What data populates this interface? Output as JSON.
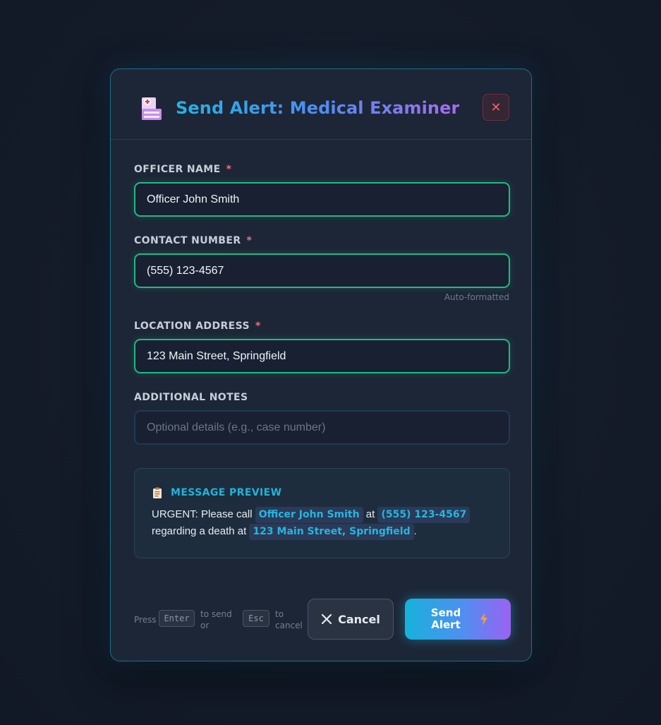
{
  "modal": {
    "title": "Send Alert: Medical Examiner",
    "icon": "hospital-icon",
    "close_label": "✕"
  },
  "form": {
    "officer_name": {
      "label": "OFFICER NAME",
      "required_mark": "*",
      "value": "Officer John Smith"
    },
    "contact_number": {
      "label": "CONTACT NUMBER",
      "required_mark": "*",
      "value": "(555) 123-4567",
      "hint": "Auto-formatted"
    },
    "location_address": {
      "label": "LOCATION ADDRESS",
      "required_mark": "*",
      "value": "123 Main Street, Springfield"
    },
    "additional_notes": {
      "label": "ADDITIONAL NOTES",
      "placeholder": "Optional details (e.g., case number)",
      "value": ""
    }
  },
  "preview": {
    "icon": "clipboard-icon",
    "title": "MESSAGE PREVIEW",
    "text_1": "URGENT: Please call ",
    "officer": "Officer John Smith",
    "text_2": " at ",
    "phone": "(555) 123-4567",
    "text_3": " regarding a death at ",
    "address": "123 Main Street, Springfield",
    "text_4": "."
  },
  "footer": {
    "press": "Press",
    "enter_key": "Enter",
    "to_send_or": "to send or",
    "esc_key": "Esc",
    "to_cancel": "to cancel",
    "cancel_label": "Cancel",
    "send_label": "Send Alert",
    "send_icon": "lightning-icon"
  },
  "colors": {
    "accent": "#22b3e4",
    "valid_border": "#22b884",
    "required": "#f2707a",
    "close": "#f0606e"
  }
}
